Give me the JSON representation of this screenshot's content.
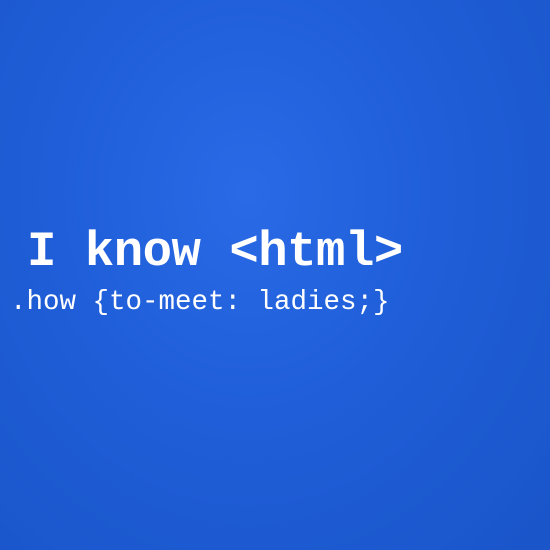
{
  "print": {
    "headline": "I know <html>",
    "subline": ".how {to-meet: ladies;}"
  },
  "colors": {
    "background": "#1f5ed8",
    "text": "#ffffff"
  }
}
